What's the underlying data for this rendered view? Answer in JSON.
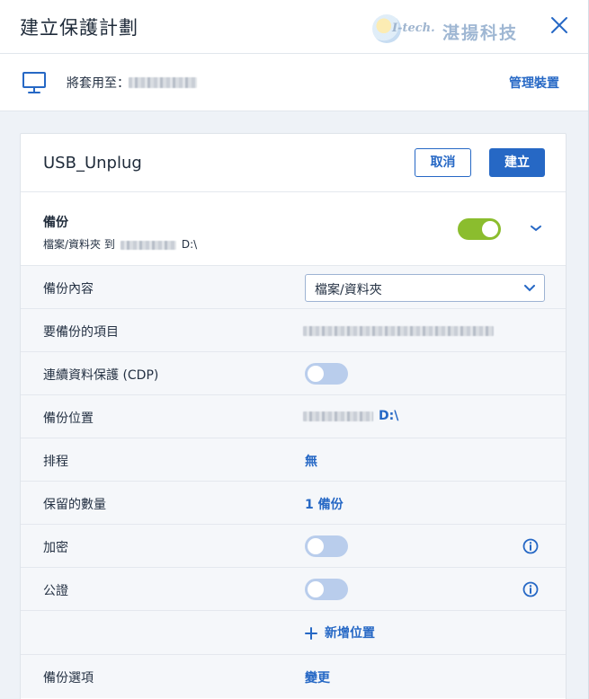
{
  "header": {
    "title": "建立保護計劃",
    "logo_tech": "I-tech.",
    "logo_cn": "湛揚科技"
  },
  "apply": {
    "label": "將套用至：",
    "manage_link": "管理裝置"
  },
  "plan": {
    "name": "USB_Unplug",
    "cancel_label": "取消",
    "create_label": "建立"
  },
  "backup": {
    "title": "備份",
    "sub_prefix": "檔案/資料夾 到",
    "sub_drive": "D:\\",
    "enabled": true
  },
  "rows": {
    "content_label": "備份內容",
    "content_value": "檔案/資料夾",
    "items_label": "要備份的項目",
    "cdp_label": "連續資料保護 (CDP)",
    "location_label": "備份位置",
    "location_drive": "D:\\",
    "schedule_label": "排程",
    "schedule_value": "無",
    "retention_label": "保留的數量",
    "retention_value": "1 備份",
    "encryption_label": "加密",
    "notary_label": "公證",
    "add_location": "新增位置",
    "options_label": "備份選項",
    "options_value": "變更"
  },
  "colors": {
    "accent": "#2668c5",
    "toggle_on": "#8bbd2e",
    "toggle_off": "#b9cdec"
  },
  "icons": [
    "close-icon",
    "monitor-icon",
    "chevron-down-icon",
    "info-icon",
    "plus-icon"
  ]
}
